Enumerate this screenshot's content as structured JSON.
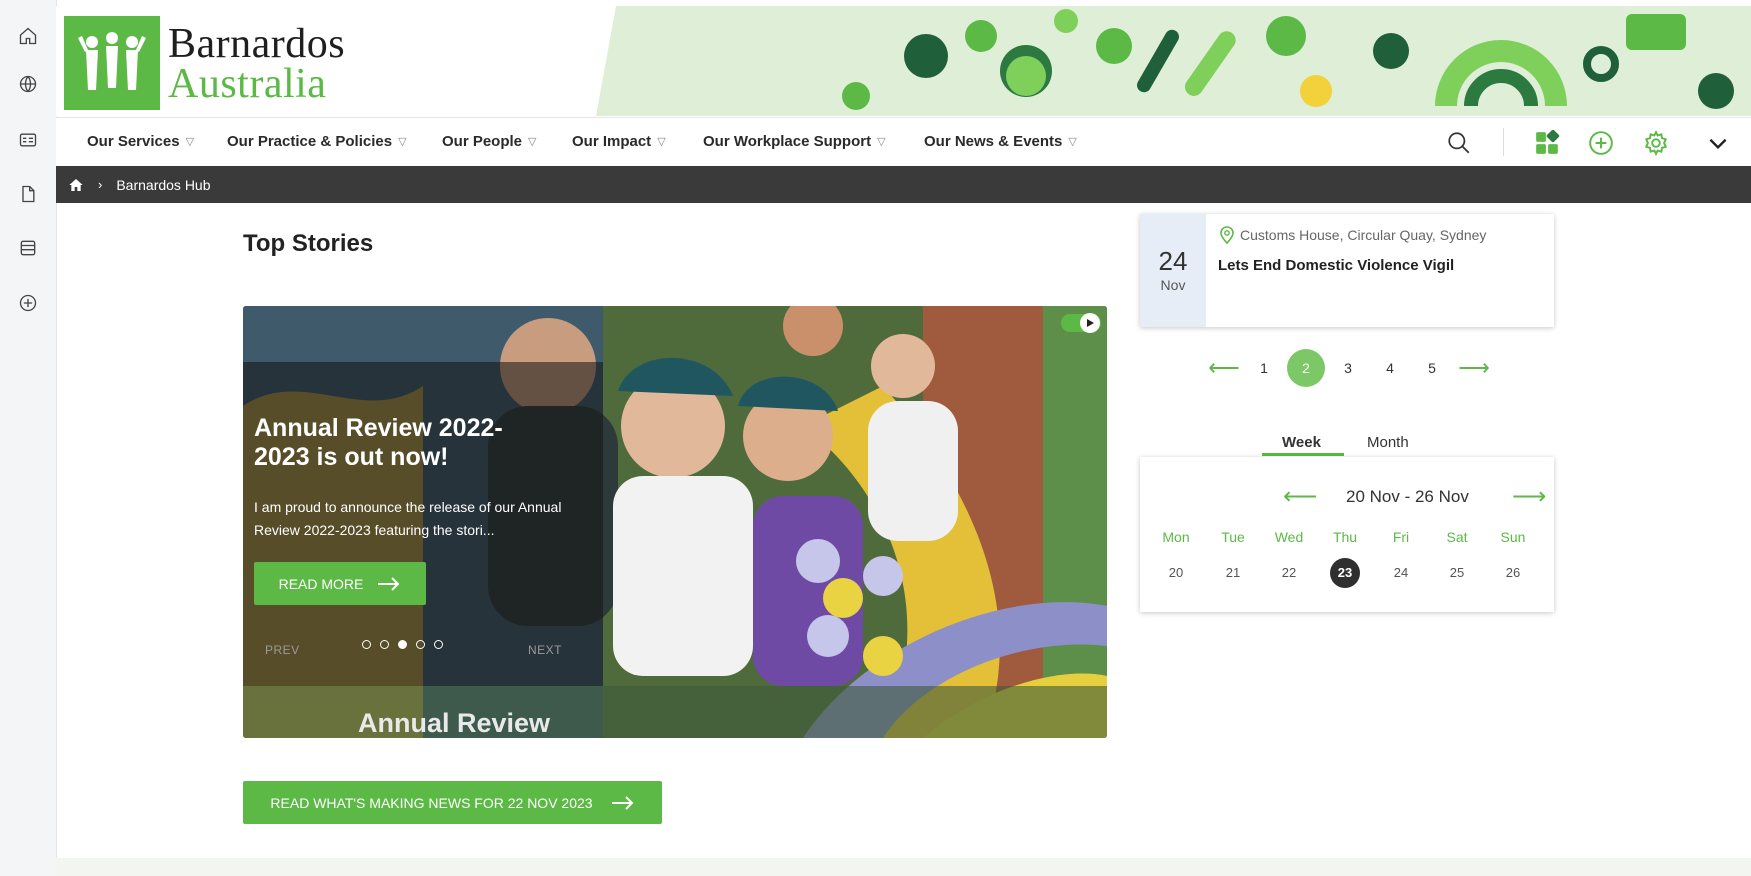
{
  "brand": {
    "line1": "Barnardos",
    "line2": "Australia",
    "color": "#5cb946"
  },
  "nav": {
    "items": [
      {
        "label": "Our Services"
      },
      {
        "label": "Our Practice & Policies"
      },
      {
        "label": "Our People"
      },
      {
        "label": "Our Impact"
      },
      {
        "label": "Our Workplace Support"
      },
      {
        "label": "Our News & Events"
      }
    ],
    "tools": [
      "search-icon",
      "apps-icon",
      "add-icon",
      "settings-icon",
      "chevron-down-icon"
    ]
  },
  "rail": {
    "icons": [
      "home-icon",
      "globe-icon",
      "id-card-icon",
      "document-icon",
      "list-icon",
      "add-circle-icon"
    ]
  },
  "breadcrumb": {
    "current": "Barnardos Hub"
  },
  "top_stories": {
    "title": "Top Stories",
    "slide": {
      "title": "Annual Review 2022-2023 is out now!",
      "excerpt": "I am proud to announce the release of our Annual Review 2022-2023 featuring the stori...",
      "cta": "READ MORE",
      "prev": "PREV",
      "next": "NEXT",
      "caption": "Annual Review",
      "dot_count": 5,
      "active_dot": 3
    },
    "news_button": "READ WHAT'S MAKING NEWS FOR 22 NOV 2023"
  },
  "event": {
    "day": "24",
    "month": "Nov",
    "location": "Customs House, Circular Quay, Sydney",
    "title": "Lets End Domestic Violence Vigil"
  },
  "pager": {
    "pages": [
      "1",
      "2",
      "3",
      "4",
      "5"
    ],
    "active": "2"
  },
  "calendar": {
    "tabs": {
      "week": "Week",
      "month": "Month"
    },
    "range": "20 Nov - 26 Nov",
    "weekdays": [
      "Mon",
      "Tue",
      "Wed",
      "Thu",
      "Fri",
      "Sat",
      "Sun"
    ],
    "days": [
      "20",
      "21",
      "22",
      "23",
      "24",
      "25",
      "26"
    ],
    "today": "23"
  }
}
